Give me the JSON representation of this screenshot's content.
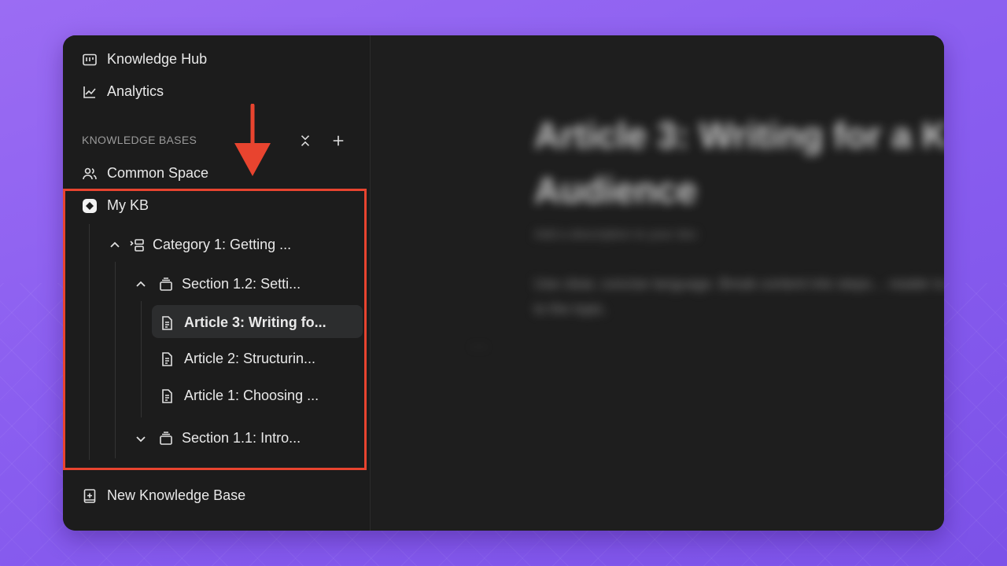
{
  "sidebar": {
    "nav": [
      {
        "label": "Knowledge Hub",
        "icon": "hub-icon"
      },
      {
        "label": "Analytics",
        "icon": "chart-icon"
      }
    ],
    "section_title": "KNOWLEDGE BASES",
    "kb_common": "Common Space",
    "kb_mine": "My KB",
    "category": "Category 1: Getting ...",
    "section_12": "Section 1.2: Setti...",
    "articles": [
      "Article 3: Writing fo...",
      "Article 2: Structurin...",
      "Article 1: Choosing ..."
    ],
    "section_11": "Section 1.1: Intro...",
    "new_kb": "New Knowledge Base"
  },
  "main": {
    "title": "Article 3: Writing for a K… Audience",
    "description": "Add a description to your doc",
    "body": "Use clear, concise language. Break content into steps… reader is new to the topic."
  },
  "colors": {
    "highlight": "#e8442f",
    "background": "#8a5ef0"
  }
}
